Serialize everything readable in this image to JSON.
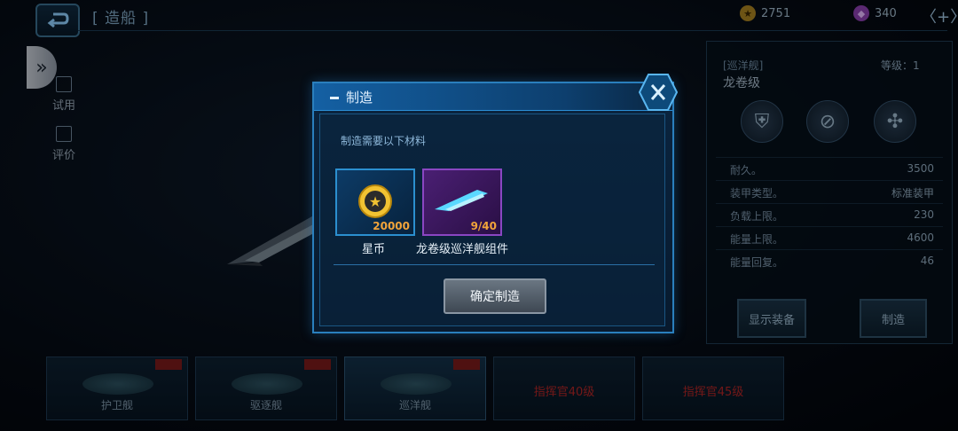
{
  "header": {
    "title": "[ 造船 ]",
    "gold_amount": "2751",
    "gem_amount": "340",
    "plus_label": "〈+〉"
  },
  "sidebar": {
    "items": [
      {
        "label": "试用"
      },
      {
        "label": "评价"
      }
    ]
  },
  "ship_panel": {
    "class": "[巡洋舰]",
    "level": "等级：1",
    "name": "龙卷级",
    "stats": [
      {
        "key": "耐久。",
        "value": "3500"
      },
      {
        "key": "装甲类型。",
        "value": "标准装甲"
      },
      {
        "key": "负载上限。",
        "value": "230"
      },
      {
        "key": "能量上限。",
        "value": "4600"
      },
      {
        "key": "能量回复。",
        "value": "46"
      }
    ],
    "show_equipment_label": "显示装备",
    "build_label": "制造"
  },
  "tabs": [
    {
      "label": "护卫舰"
    },
    {
      "label": "驱逐舰"
    },
    {
      "label": "巡洋舰"
    },
    {
      "label": "指挥官40级"
    },
    {
      "label": "指挥官45级"
    }
  ],
  "modal": {
    "title": "制造",
    "prompt": "制造需要以下材料",
    "materials": [
      {
        "name": "星币",
        "qty": "20000"
      },
      {
        "name": "龙卷级巡洋舰组件",
        "qty": "9/40"
      }
    ],
    "confirm_label": "确定制造"
  },
  "colors": {
    "accent": "#2a7fbd",
    "locked_red": "#b12525",
    "qty_orange": "#f2a43a"
  }
}
